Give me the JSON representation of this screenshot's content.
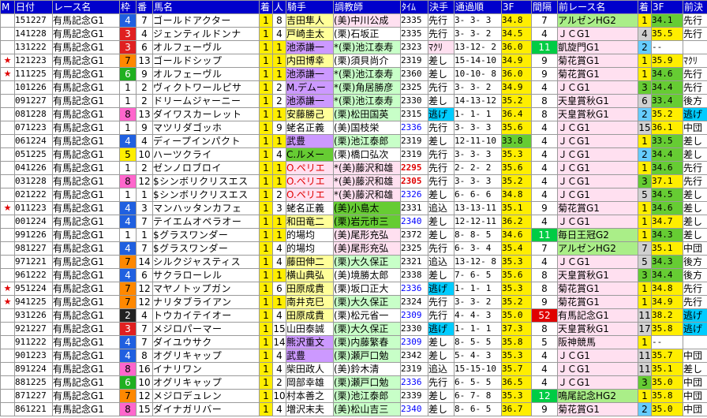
{
  "header": [
    "M",
    "日付",
    "レース名",
    "枠",
    "番",
    "馬名",
    "着",
    "人",
    "騎手",
    "調教師",
    "ﾀｲﾑ",
    "決手",
    "通過順",
    "3F",
    "間隔",
    "前レース名",
    "着",
    "3F",
    "前決"
  ],
  "rows": [
    {
      "mk": "",
      "date": "151227",
      "race": "有馬記念G1",
      "waku": "4",
      "ban": "7",
      "name": "ゴールドアクター",
      "chaku": "1",
      "pop": "8",
      "jockey": "吉田隼人",
      "trainer": "(美)中川公成",
      "time": "2335",
      "kimete": "先行",
      "pass": "3- 3- 3",
      "f3": "34.8",
      "gap": "7",
      "prev": "アルゼンHG2",
      "pchaku": "1",
      "p3f": "34.1",
      "pk": "先行"
    },
    {
      "mk": "",
      "date": "141228",
      "race": "有馬記念G1",
      "waku": "3",
      "ban": "4",
      "name": "ジェンティルドンナ",
      "chaku": "1",
      "pop": "4",
      "jockey": "戸崎圭太",
      "trainer": "(栗)石坂正",
      "time": "2335",
      "kimete": "先行",
      "pass": "3- 3- 2",
      "f3": "34.5",
      "gap": "4",
      "prev": "ＪＣG1",
      "pchaku": "4",
      "p3f": "35.5",
      "pk": "先行"
    },
    {
      "mk": "",
      "date": "131222",
      "race": "有馬記念G1",
      "waku": "3",
      "ban": "6",
      "name": "オルフェーヴル",
      "chaku": "1",
      "pop": "1",
      "jockey": "池添謙一",
      "trainer": "*(栗)池江泰寿",
      "time": "2323",
      "kimete": "ﾏｸﾘ",
      "pass": "13-12- 2",
      "f3": "36.0",
      "gap": "11",
      "prev": "凱旋門G1",
      "pchaku": "2",
      "p3f": "--",
      "pk": ""
    },
    {
      "mk": "★",
      "date": "121223",
      "race": "有馬記念G1",
      "waku": "7",
      "ban": "13",
      "name": "ゴールドシップ",
      "chaku": "1",
      "pop": "1",
      "jockey": "内田博幸",
      "trainer": "(栗)須貝尚介",
      "time": "2319",
      "kimete": "差し",
      "pass": "15-14-10",
      "f3": "34.9",
      "gap": "9",
      "prev": "菊花賞G1",
      "pchaku": "1",
      "p3f": "35.9",
      "pk": "ﾏｸﾘ"
    },
    {
      "mk": "★",
      "date": "111225",
      "race": "有馬記念G1",
      "waku": "6",
      "ban": "9",
      "name": "オルフェーヴル",
      "chaku": "1",
      "pop": "1",
      "jockey": "池添謙一",
      "trainer": "*(栗)池江泰寿",
      "time": "2360",
      "kimete": "差し",
      "pass": "10-10- 8",
      "f3": "36.0",
      "gap": "9",
      "prev": "菊花賞G1",
      "pchaku": "1",
      "p3f": "34.6",
      "pk": "先行"
    },
    {
      "mk": "",
      "date": "101226",
      "race": "有馬記念G1",
      "waku": "1",
      "ban": "2",
      "name": "ヴィクトワールピサ",
      "chaku": "1",
      "pop": "2",
      "jockey": "M.デムー",
      "trainer": "*(栗)角居勝彦",
      "time": "2325",
      "kimete": "先行",
      "pass": "3- 3- 2",
      "f3": "34.9",
      "gap": "4",
      "prev": "ＪＣG1",
      "pchaku": "3",
      "p3f": "34.4",
      "pk": "先行"
    },
    {
      "mk": "",
      "date": "091227",
      "race": "有馬記念G1",
      "waku": "1",
      "ban": "2",
      "name": "ドリームジャーニー",
      "chaku": "1",
      "pop": "2",
      "jockey": "池添謙一",
      "trainer": "*(栗)池江泰寿",
      "time": "2330",
      "kimete": "差し",
      "pass": "14-13-12",
      "f3": "35.2",
      "gap": "8",
      "prev": "天皇賞秋G1",
      "pchaku": "6",
      "p3f": "33.4",
      "pk": "後方"
    },
    {
      "mk": "",
      "date": "081228",
      "race": "有馬記念G1",
      "waku": "8",
      "ban": "13",
      "name": "ダイワスカーレット",
      "chaku": "1",
      "pop": "1",
      "jockey": "安藤勝己",
      "trainer": "(栗)松田国英",
      "time": "2315",
      "kimete": "逃げ",
      "pass": "1- 1- 1",
      "f3": "36.4",
      "gap": "8",
      "prev": "天皇賞秋G1",
      "pchaku": "2",
      "p3f": "35.2",
      "pk": "逃げ"
    },
    {
      "mk": "",
      "date": "071223",
      "race": "有馬記念G1",
      "waku": "1",
      "ban": "9",
      "name": "マツリダゴッホ",
      "chaku": "1",
      "pop": "9",
      "jockey": "蛯名正義",
      "trainer": "(美)国枝栄",
      "time": "2336",
      "kimete": "先行",
      "pass": "3- 3- 3",
      "f3": "35.6",
      "gap": "4",
      "prev": "ＪＣG1",
      "pchaku": "15",
      "p3f": "36.1",
      "pk": "中団"
    },
    {
      "mk": "",
      "date": "061224",
      "race": "有馬記念G1",
      "waku": "4",
      "ban": "4",
      "name": "ディープインパクト",
      "chaku": "1",
      "pop": "1",
      "jockey": "武豊",
      "trainer": "(栗)池江泰郎",
      "time": "2319",
      "kimete": "差し",
      "pass": "12-11-10",
      "f3": "33.8",
      "gap": "4",
      "prev": "ＪＣG1",
      "pchaku": "1",
      "p3f": "33.5",
      "pk": "差し"
    },
    {
      "mk": "",
      "date": "051225",
      "race": "有馬記念G1",
      "waku": "5",
      "ban": "10",
      "name": "ハーツクライ",
      "chaku": "1",
      "pop": "4",
      "jockey": "C.ルメー",
      "trainer": "(栗)橋口弘次",
      "time": "2319",
      "kimete": "先行",
      "pass": "3- 3- 3",
      "f3": "35.3",
      "gap": "4",
      "prev": "ＪＣG1",
      "pchaku": "2",
      "p3f": "34.4",
      "pk": "差し"
    },
    {
      "mk": "",
      "date": "041226",
      "race": "有馬記念G1",
      "waku": "1",
      "ban": "2",
      "name": "ゼンノロブロイ",
      "chaku": "1",
      "pop": "1",
      "jockey": "O.ペリエ",
      "trainer": "*(美)藤沢和雄",
      "time": "2295",
      "kimete": "先行",
      "pass": "2- 2- 2",
      "f3": "35.6",
      "gap": "4",
      "prev": "ＪＣG1",
      "pchaku": "1",
      "p3f": "34.6",
      "pk": "先行"
    },
    {
      "mk": "",
      "date": "031228",
      "race": "有馬記念G1",
      "waku": "8",
      "ban": "12",
      "name": "$シンボリクリスエス",
      "chaku": "1",
      "pop": "1",
      "jockey": "O.ペリエ",
      "trainer": "*(美)藤沢和雄",
      "time": "2305",
      "kimete": "先行",
      "pass": "3- 3- 3",
      "f3": "35.2",
      "gap": "4",
      "prev": "ＪＣG1",
      "pchaku": "3",
      "p3f": "37.1",
      "pk": "先行"
    },
    {
      "mk": "",
      "date": "021222",
      "race": "有馬記念G1",
      "waku": "1",
      "ban": "1",
      "name": "$シンボリクリスエス",
      "chaku": "1",
      "pop": "2",
      "jockey": "O.ペリエ",
      "trainer": "*(美)藤沢和雄",
      "time": "2326",
      "kimete": "差し",
      "pass": "6- 6- 6",
      "f3": "34.8",
      "gap": "4",
      "prev": "ＪＣG1",
      "pchaku": "5",
      "p3f": "34.5",
      "pk": "差し"
    },
    {
      "mk": "★",
      "date": "011223",
      "race": "有馬記念G1",
      "waku": "4",
      "ban": "3",
      "name": "マンハッタンカフェ",
      "chaku": "1",
      "pop": "3",
      "jockey": "蛯名正義",
      "trainer": "(美)小島太",
      "time": "2331",
      "kimete": "追込",
      "pass": "13-13-11",
      "f3": "35.1",
      "gap": "9",
      "prev": "菊花賞G1",
      "pchaku": "1",
      "p3f": "34.6",
      "pk": "差し"
    },
    {
      "mk": "",
      "date": "001224",
      "race": "有馬記念G1",
      "waku": "4",
      "ban": "7",
      "name": "テイエムオペラオー",
      "chaku": "1",
      "pop": "1",
      "jockey": "和田竜二",
      "trainer": "(栗)岩元市三",
      "time": "2340",
      "kimete": "差し",
      "pass": "12-12-11",
      "f3": "36.2",
      "gap": "4",
      "prev": "ＪＣG1",
      "pchaku": "1",
      "p3f": "34.7",
      "pk": "差し"
    },
    {
      "mk": "",
      "date": "991226",
      "race": "有馬記念G1",
      "waku": "1",
      "ban": "1",
      "name": "$グラスワンダー",
      "chaku": "1",
      "pop": "1",
      "jockey": "的場均",
      "trainer": "(美)尾形充弘",
      "time": "2372",
      "kimete": "差し",
      "pass": "8- 8- 5",
      "f3": "34.6",
      "gap": "11",
      "prev": "毎日王冠G2",
      "pchaku": "1",
      "p3f": "34.3",
      "pk": "差し"
    },
    {
      "mk": "",
      "date": "981227",
      "race": "有馬記念G1",
      "waku": "4",
      "ban": "7",
      "name": "$グラスワンダー",
      "chaku": "1",
      "pop": "4",
      "jockey": "的場均",
      "trainer": "(美)尾形充弘",
      "time": "2325",
      "kimete": "先行",
      "pass": "6- 3- 4",
      "f3": "35.4",
      "gap": "7",
      "prev": "アルゼンHG2",
      "pchaku": "7",
      "p3f": "35.1",
      "pk": "中団"
    },
    {
      "mk": "",
      "date": "971221",
      "race": "有馬記念G1",
      "waku": "7",
      "ban": "14",
      "name": "シルクジャスティス",
      "chaku": "1",
      "pop": "4",
      "jockey": "藤田伸二",
      "trainer": "(栗)大久保正",
      "time": "2321",
      "kimete": "追込",
      "pass": "13-12- 8",
      "f3": "35.3",
      "gap": "4",
      "prev": "ＪＣG1",
      "pchaku": "5",
      "p3f": "34.3",
      "pk": "後方"
    },
    {
      "mk": "",
      "date": "961222",
      "race": "有馬記念G1",
      "waku": "4",
      "ban": "6",
      "name": "サクラローレル",
      "chaku": "1",
      "pop": "1",
      "jockey": "横山典弘",
      "trainer": "(美)境勝太郎",
      "time": "2338",
      "kimete": "差し",
      "pass": "7- 6- 5",
      "f3": "35.6",
      "gap": "8",
      "prev": "天皇賞秋G1",
      "pchaku": "3",
      "p3f": "34.4",
      "pk": "後方"
    },
    {
      "mk": "★",
      "date": "951224",
      "race": "有馬記念G1",
      "waku": "7",
      "ban": "12",
      "name": "マヤノトップガン",
      "chaku": "1",
      "pop": "6",
      "jockey": "田原成貴",
      "trainer": "(栗)坂口正大",
      "time": "2336",
      "kimete": "逃げ",
      "pass": "1- 1- 1",
      "f3": "35.3",
      "gap": "8",
      "prev": "菊花賞G1",
      "pchaku": "1",
      "p3f": "34.8",
      "pk": "先行"
    },
    {
      "mk": "★",
      "date": "941225",
      "race": "有馬記念G1",
      "waku": "7",
      "ban": "12",
      "name": "ナリタブライアン",
      "chaku": "1",
      "pop": "1",
      "jockey": "南井克巳",
      "trainer": "(栗)大久保正",
      "time": "2324",
      "kimete": "先行",
      "pass": "3- 3- 2",
      "f3": "35.2",
      "gap": "9",
      "prev": "菊花賞G1",
      "pchaku": "1",
      "p3f": "34.9",
      "pk": "先行"
    },
    {
      "mk": "",
      "date": "931226",
      "race": "有馬記念G1",
      "waku": "2",
      "ban": "4",
      "name": "トウカイテイオー",
      "chaku": "1",
      "pop": "4",
      "jockey": "田原成貴",
      "trainer": "(栗)松元省一",
      "time": "2309",
      "kimete": "先行",
      "pass": "4- 4- 3",
      "f3": "35.0",
      "gap": "52",
      "prev": "有馬記念G1",
      "pchaku": "11",
      "p3f": "38.2",
      "pk": "逃げ"
    },
    {
      "mk": "",
      "date": "921227",
      "race": "有馬記念G1",
      "waku": "3",
      "ban": "7",
      "name": "メジロパーマー",
      "chaku": "1",
      "pop": "15",
      "jockey": "山田泰誠",
      "trainer": "(栗)大久保正",
      "time": "2330",
      "kimete": "逃げ",
      "pass": "1- 1- 1",
      "f3": "37.3",
      "gap": "8",
      "prev": "天皇賞秋G1",
      "pchaku": "17",
      "p3f": "35.8",
      "pk": "逃げ"
    },
    {
      "mk": "",
      "date": "911222",
      "race": "有馬記念G1",
      "waku": "4",
      "ban": "7",
      "name": "ダイユウサク",
      "chaku": "1",
      "pop": "14",
      "jockey": "熊沢重文",
      "trainer": "(栗)内藤繁春",
      "time": "2309",
      "kimete": "差し",
      "pass": "8- 5- 5",
      "f3": "35.8",
      "gap": "5",
      "prev": "阪神競馬",
      "pchaku": "1",
      "p3f": "--",
      "pk": ""
    },
    {
      "mk": "",
      "date": "901223",
      "race": "有馬記念G1",
      "waku": "4",
      "ban": "8",
      "name": "オグリキャップ",
      "chaku": "1",
      "pop": "4",
      "jockey": "武豊",
      "trainer": "(栗)瀬戸口勉",
      "time": "2342",
      "kimete": "差し",
      "pass": "5- 4- 3",
      "f3": "35.3",
      "gap": "4",
      "prev": "ＪＣG1",
      "pchaku": "11",
      "p3f": "35.7",
      "pk": "中団"
    },
    {
      "mk": "",
      "date": "891224",
      "race": "有馬記念G1",
      "waku": "8",
      "ban": "16",
      "name": "イナリワン",
      "chaku": "1",
      "pop": "4",
      "jockey": "柴田政人",
      "trainer": "(美)鈴木清",
      "time": "2319",
      "kimete": "追込",
      "pass": "15-15-10",
      "f3": "35.7",
      "gap": "4",
      "prev": "ＪＣG1",
      "pchaku": "11",
      "p3f": "35.1",
      "pk": "差し"
    },
    {
      "mk": "",
      "date": "881225",
      "race": "有馬記念G1",
      "waku": "6",
      "ban": "10",
      "name": "オグリキャップ",
      "chaku": "1",
      "pop": "2",
      "jockey": "岡部幸雄",
      "trainer": "(栗)瀬戸口勉",
      "time": "2336",
      "kimete": "先行",
      "pass": "6- 5- 5",
      "f3": "36.5",
      "gap": "4",
      "prev": "ＪＣG1",
      "pchaku": "3",
      "p3f": "35.0",
      "pk": "中団"
    },
    {
      "mk": "",
      "date": "871227",
      "race": "有馬記念G1",
      "waku": "7",
      "ban": "12",
      "name": "メジロデュレン",
      "chaku": "1",
      "pop": "10",
      "jockey": "村本善之",
      "trainer": "(栗)池江泰郎",
      "time": "2339",
      "kimete": "差し",
      "pass": "6- 7- 8",
      "f3": "35.3",
      "gap": "12",
      "prev": "鳴尾記念HG2",
      "pchaku": "1",
      "p3f": "35.8",
      "pk": "中団"
    },
    {
      "mk": "",
      "date": "861221",
      "race": "有馬記念G1",
      "waku": "8",
      "ban": "15",
      "name": "ダイナガリバー",
      "chaku": "1",
      "pop": "4",
      "jockey": "増沢末夫",
      "trainer": "(美)松山吉三",
      "time": "2340",
      "kimete": "差し",
      "pass": "8- 6- 5",
      "f3": "36.7",
      "gap": "9",
      "prev": "菊花賞G1",
      "pchaku": "2",
      "p3f": "35.0",
      "pk": "中団"
    }
  ]
}
